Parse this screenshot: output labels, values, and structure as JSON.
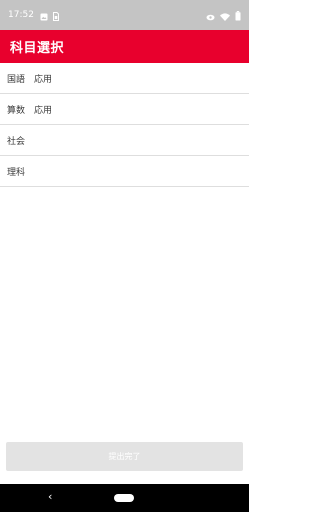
{
  "status_bar": {
    "time": "17:52",
    "left_icons": [
      "image-icon",
      "sim-card-icon"
    ],
    "right_icons": [
      "eye-icon",
      "wifi-icon",
      "battery-icon"
    ]
  },
  "app_bar": {
    "title": "科目選択",
    "background_color": "#e8002d"
  },
  "subjects": [
    {
      "label": "国語　応用"
    },
    {
      "label": "算数　応用"
    },
    {
      "label": "社会"
    },
    {
      "label": "理科"
    }
  ],
  "submit": {
    "label": "提出完了",
    "enabled": false
  },
  "nav_bar": {
    "back_glyph": "‹"
  }
}
